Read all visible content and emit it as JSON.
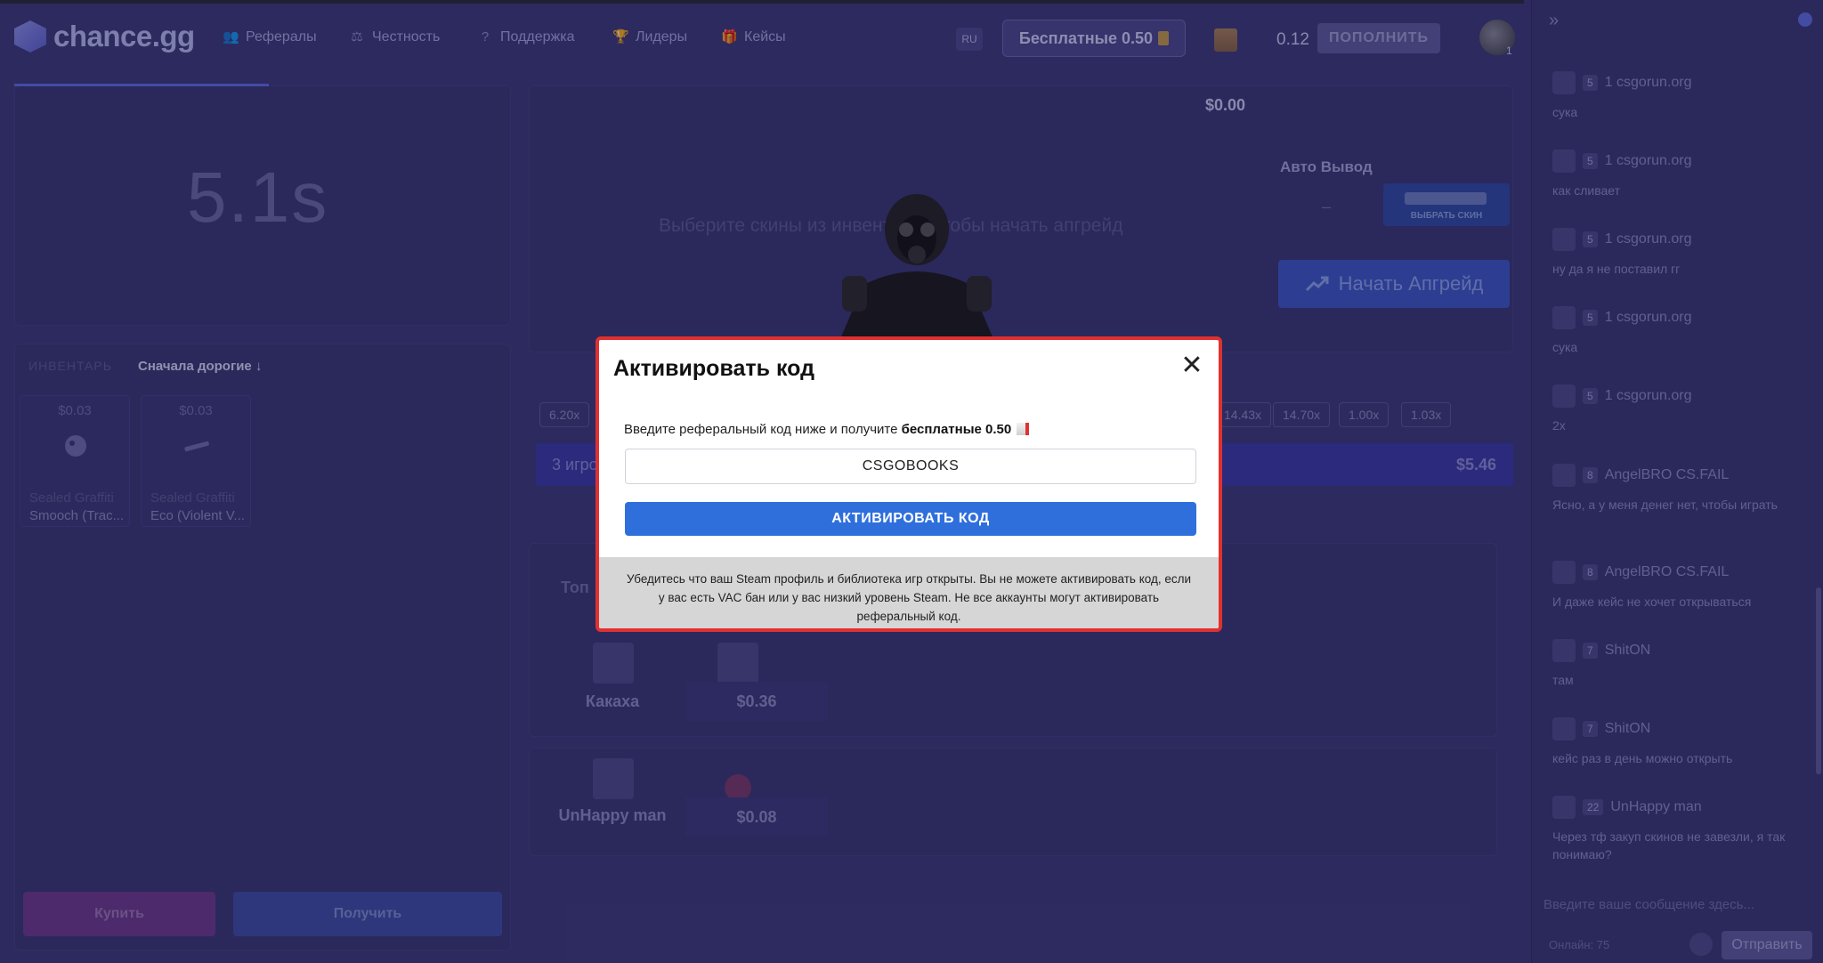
{
  "header": {
    "logo": "chance.gg",
    "nav": [
      {
        "label": "Рефералы",
        "icon": "users-icon",
        "glyph": "👥"
      },
      {
        "label": "Честность",
        "icon": "scales-icon",
        "glyph": "⚖"
      },
      {
        "label": "Поддержка",
        "icon": "help-icon",
        "glyph": "?"
      },
      {
        "label": "Лидеры",
        "icon": "trophy-icon",
        "glyph": "🏆"
      },
      {
        "label": "Кейсы",
        "icon": "case-icon",
        "glyph": "🎁"
      }
    ],
    "lang": "RU",
    "free_btn": "Бесплатные 0.50",
    "balance": "0.12",
    "topup": "ПОПОЛНИТЬ",
    "avatar_badge": "1"
  },
  "left": {
    "timer": "5.1s",
    "inventory_label": "ИНВЕНТАРЬ",
    "sort_label": "Сначала дорогие ↓",
    "items": [
      {
        "price": "$0.03",
        "name1": "Sealed Graffiti",
        "name2": "Smooch (Trac..."
      },
      {
        "price": "$0.03",
        "name1": "Sealed Graffiti",
        "name2": "Eco (Violent V..."
      }
    ],
    "buy": "Купить",
    "get": "Получить"
  },
  "center": {
    "money": "$0.00",
    "hint": "Выберите скины из инвентаря, чтобы начать апгрейд",
    "auto_label": "Авто Вывод",
    "auto_value": "–",
    "choose_skin": "ВЫБРАТЬ СКИН",
    "upgrade": "Начать Апгрейд",
    "multipliers": [
      "6.20x",
      "14.43x",
      "14.70x",
      "1.00x",
      "1.03x"
    ],
    "players": "3 игрока",
    "pot": "$5.46",
    "top_label": "Топ",
    "winners": [
      {
        "name": "Какаха",
        "value": "$0.36"
      },
      {
        "name": "UnHappy man",
        "value": "$0.08"
      }
    ]
  },
  "chat": {
    "messages": [
      {
        "level": "5",
        "user": "1 csgorun.org",
        "text": "сука"
      },
      {
        "level": "5",
        "user": "1 csgorun.org",
        "text": "как сливает"
      },
      {
        "level": "5",
        "user": "1 csgorun.org",
        "text": "ну да я не поставил гг"
      },
      {
        "level": "5",
        "user": "1 csgorun.org",
        "text": "сука"
      },
      {
        "level": "5",
        "user": "1 csgorun.org",
        "text": "2x"
      },
      {
        "level": "8",
        "user": "AngelBRO CS.FAIL",
        "text": "Ясно, а у меня денег нет, чтобы играть"
      },
      {
        "level": "8",
        "user": "AngelBRO CS.FAIL",
        "text": "И даже кейс не хочет открываться"
      },
      {
        "level": "7",
        "user": "ShitON",
        "text": "там"
      },
      {
        "level": "7",
        "user": "ShitON",
        "text": "кейс раз в день можно открыть"
      },
      {
        "level": "22",
        "user": "UnHappy man",
        "text": "Через тф закуп скинов не завезли, я так понимаю?"
      }
    ],
    "input_placeholder": "Введите ваше сообщение здесь...",
    "online": "Онлайн: 75",
    "send": "Отправить"
  },
  "modal": {
    "title": "Активировать код",
    "desc_prefix": "Введите реферальный код ниже и получите ",
    "desc_bold": "бесплатные 0.50",
    "code_value": "CSGOBOOKS",
    "activate": "АКТИВИРОВАТЬ КОД",
    "footer": "Убедитесь что ваш Steam профиль и библиотека игр открыты. Вы не можете активировать код, если у вас есть VAC бан или у вас низкий уровень Steam. Не все аккаунты могут активировать реферальный код."
  },
  "colors": {
    "bg": "#3d3a7a",
    "modal_border": "#e03131",
    "activate": "#2f6fdc"
  }
}
